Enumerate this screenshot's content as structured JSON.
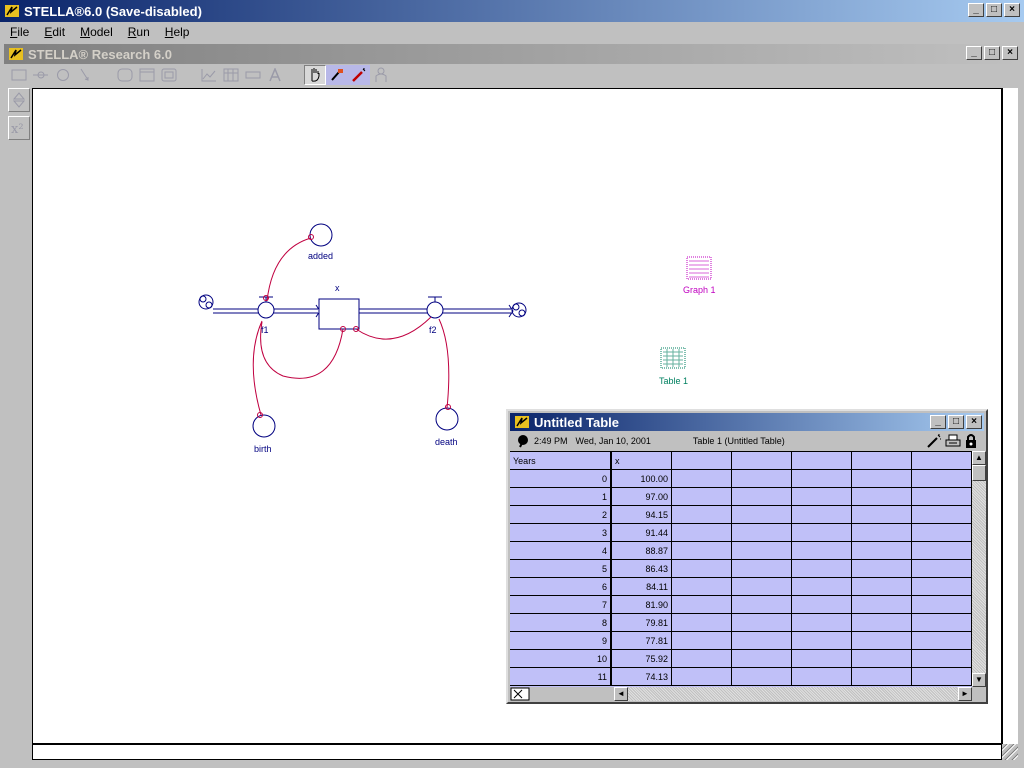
{
  "app": {
    "title": "STELLA®6.0 (Save-disabled)",
    "inner_title": "STELLA® Research 6.0"
  },
  "window_buttons": {
    "minimize": "_",
    "maximize": "□",
    "close": "×"
  },
  "menu": [
    {
      "key": "F",
      "rest": "ile"
    },
    {
      "key": "E",
      "rest": "dit"
    },
    {
      "key": "M",
      "rest": "odel"
    },
    {
      "key": "R",
      "rest": "un"
    },
    {
      "key": "H",
      "rest": "elp"
    }
  ],
  "diagram": {
    "stock": "x",
    "flows": [
      "f1",
      "f2"
    ],
    "converters": [
      "added",
      "birth",
      "death"
    ],
    "objects": {
      "graph": "Graph 1",
      "table": "Table 1"
    },
    "colors": {
      "structure": "#000080",
      "connector": "#c00040",
      "graph": "#c000c0",
      "table": "#008060"
    }
  },
  "table_window": {
    "title": "Untitled Table",
    "time": "2:49 PM",
    "date": "Wed, Jan 10, 2001",
    "table_name": "Table 1 (Untitled Table)",
    "columns": [
      "Years",
      "x"
    ],
    "rows": [
      [
        "0",
        "100.00"
      ],
      [
        "1",
        "97.00"
      ],
      [
        "2",
        "94.15"
      ],
      [
        "3",
        "91.44"
      ],
      [
        "4",
        "88.87"
      ],
      [
        "5",
        "86.43"
      ],
      [
        "6",
        "84.11"
      ],
      [
        "7",
        "81.90"
      ],
      [
        "8",
        "79.81"
      ],
      [
        "9",
        "77.81"
      ],
      [
        "10",
        "75.92"
      ],
      [
        "11",
        "74.13"
      ]
    ],
    "row_color": "#c0c0f8"
  }
}
